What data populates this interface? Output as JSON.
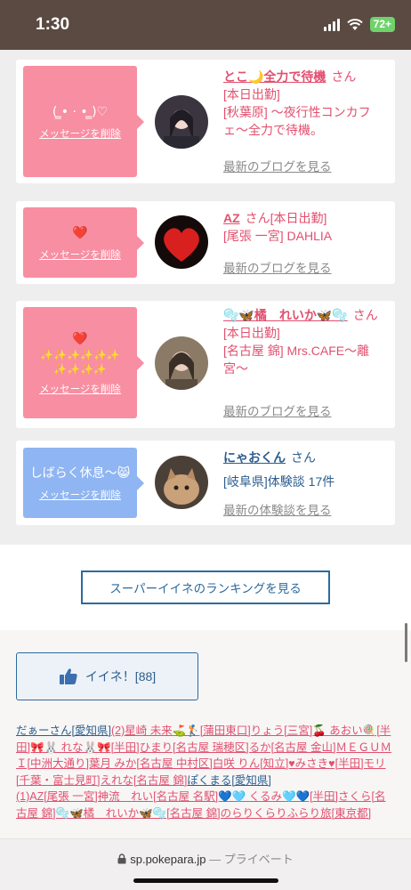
{
  "status_bar": {
    "time": "1:30",
    "battery": "72+"
  },
  "messages": [
    {
      "bubble_text": "( ̳• · • ̳)♡",
      "delete_label": "メッセージを削除",
      "name": "とこ🌙全力で待機",
      "honorific": "さん",
      "lines": [
        "[本日出勤]",
        "[秋葉原] 〜夜行性コンカフェ〜全力で待機。"
      ],
      "link": "最新のブログを見る"
    },
    {
      "bubble_text": "❤️",
      "delete_label": "メッセージを削除",
      "name": "AZ",
      "honorific": "さん",
      "tag": "[本日出勤]",
      "lines": [
        "[尾張 一宮] DAHLIA"
      ],
      "link": "最新のブログを見る"
    },
    {
      "bubble_text": "❤️",
      "bubble_text2": "✨✨✨✨✨✨",
      "bubble_text3": "✨✨✨✨",
      "delete_label": "メッセージを削除",
      "name": "🫧🦋橘　れいか🦋🫧",
      "honorific": "さん",
      "lines": [
        "[本日出勤]",
        "[名古屋 錦] Mrs.CAFE〜離宮〜"
      ],
      "link": "最新のブログを見る"
    },
    {
      "bubble_text": "しばらく休息〜😸",
      "delete_label": "メッセージを削除",
      "name": "にゃおくん",
      "honorific": "さん",
      "lines": [
        "[岐阜県]体験談 17件"
      ],
      "link": "最新の体験談を見る"
    }
  ],
  "ranking_button": "スーパーイイネのランキングを見る",
  "like_button": {
    "label": "イイネ！[88]"
  },
  "likers": [
    "だぁーさん[愛知県]",
    "(2)星崎 未来⛳🏌️[蒲田東口]りょう[三宮]🍒 あおい🍭[半田]🎀🐰 れな🐰🎀[半田]ひまり[名古屋 瑞穂区]るか[名古屋 金山]ＭＥＧＵＭＩ[中洲大通り]葉月 みか[名古屋 中村区]白咲 りん[知立]♥みさき♥[半田]モリ[千葉・富士見町]えれな[名古屋 錦]",
    "ぽくまる[愛知県]",
    "(1)AZ[尾張 一宮]神流　れい[名古屋 名駅]💙🩵 くるみ🩵💙[半田]さくら[名古屋 錦]🫧🦋橘　れいか🦋🫧[名古屋 錦]のらりくらりふらり旅[東京都]"
  ],
  "url_bar": {
    "domain": "sp.pokepara.jp",
    "suffix": "— プライベート"
  },
  "colors": {
    "accent_pink": "#e2506f",
    "bubble_pink": "#f88ea1",
    "bubble_blue": "#8fb5f2",
    "link_blue": "#2c5e8e",
    "header_brown": "#5a4a42"
  }
}
